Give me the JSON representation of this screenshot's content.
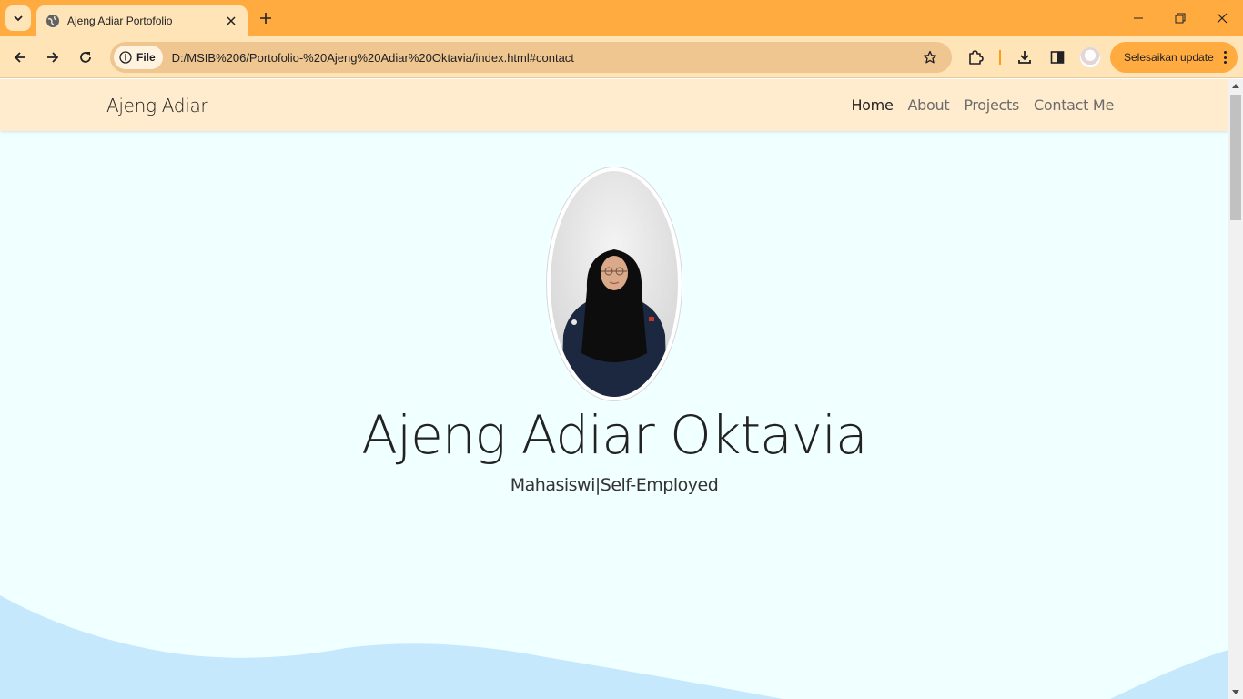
{
  "browser": {
    "tab_title": "Ajeng Adiar Portofolio",
    "url_chip": "File",
    "url": "D:/MSIB%206/Portofolio-%20Ajeng%20Adiar%20Oktavia/index.html#contact",
    "update_label": "Selesaikan update",
    "accent_color": "#ffab40",
    "toolbar_color": "#ffe4b8"
  },
  "navbar": {
    "brand": "Ajeng Adiar",
    "links": [
      {
        "label": "Home",
        "active": true
      },
      {
        "label": "About",
        "active": false
      },
      {
        "label": "Projects",
        "active": false
      },
      {
        "label": "Contact Me",
        "active": false
      }
    ],
    "background": "#ffebcd"
  },
  "hero": {
    "name": "Ajeng Adiar Oktavia",
    "subtitle": "Mahasiswi|Self-Employed",
    "background": "#f0ffff",
    "wave_color": "#c6e8fd"
  }
}
